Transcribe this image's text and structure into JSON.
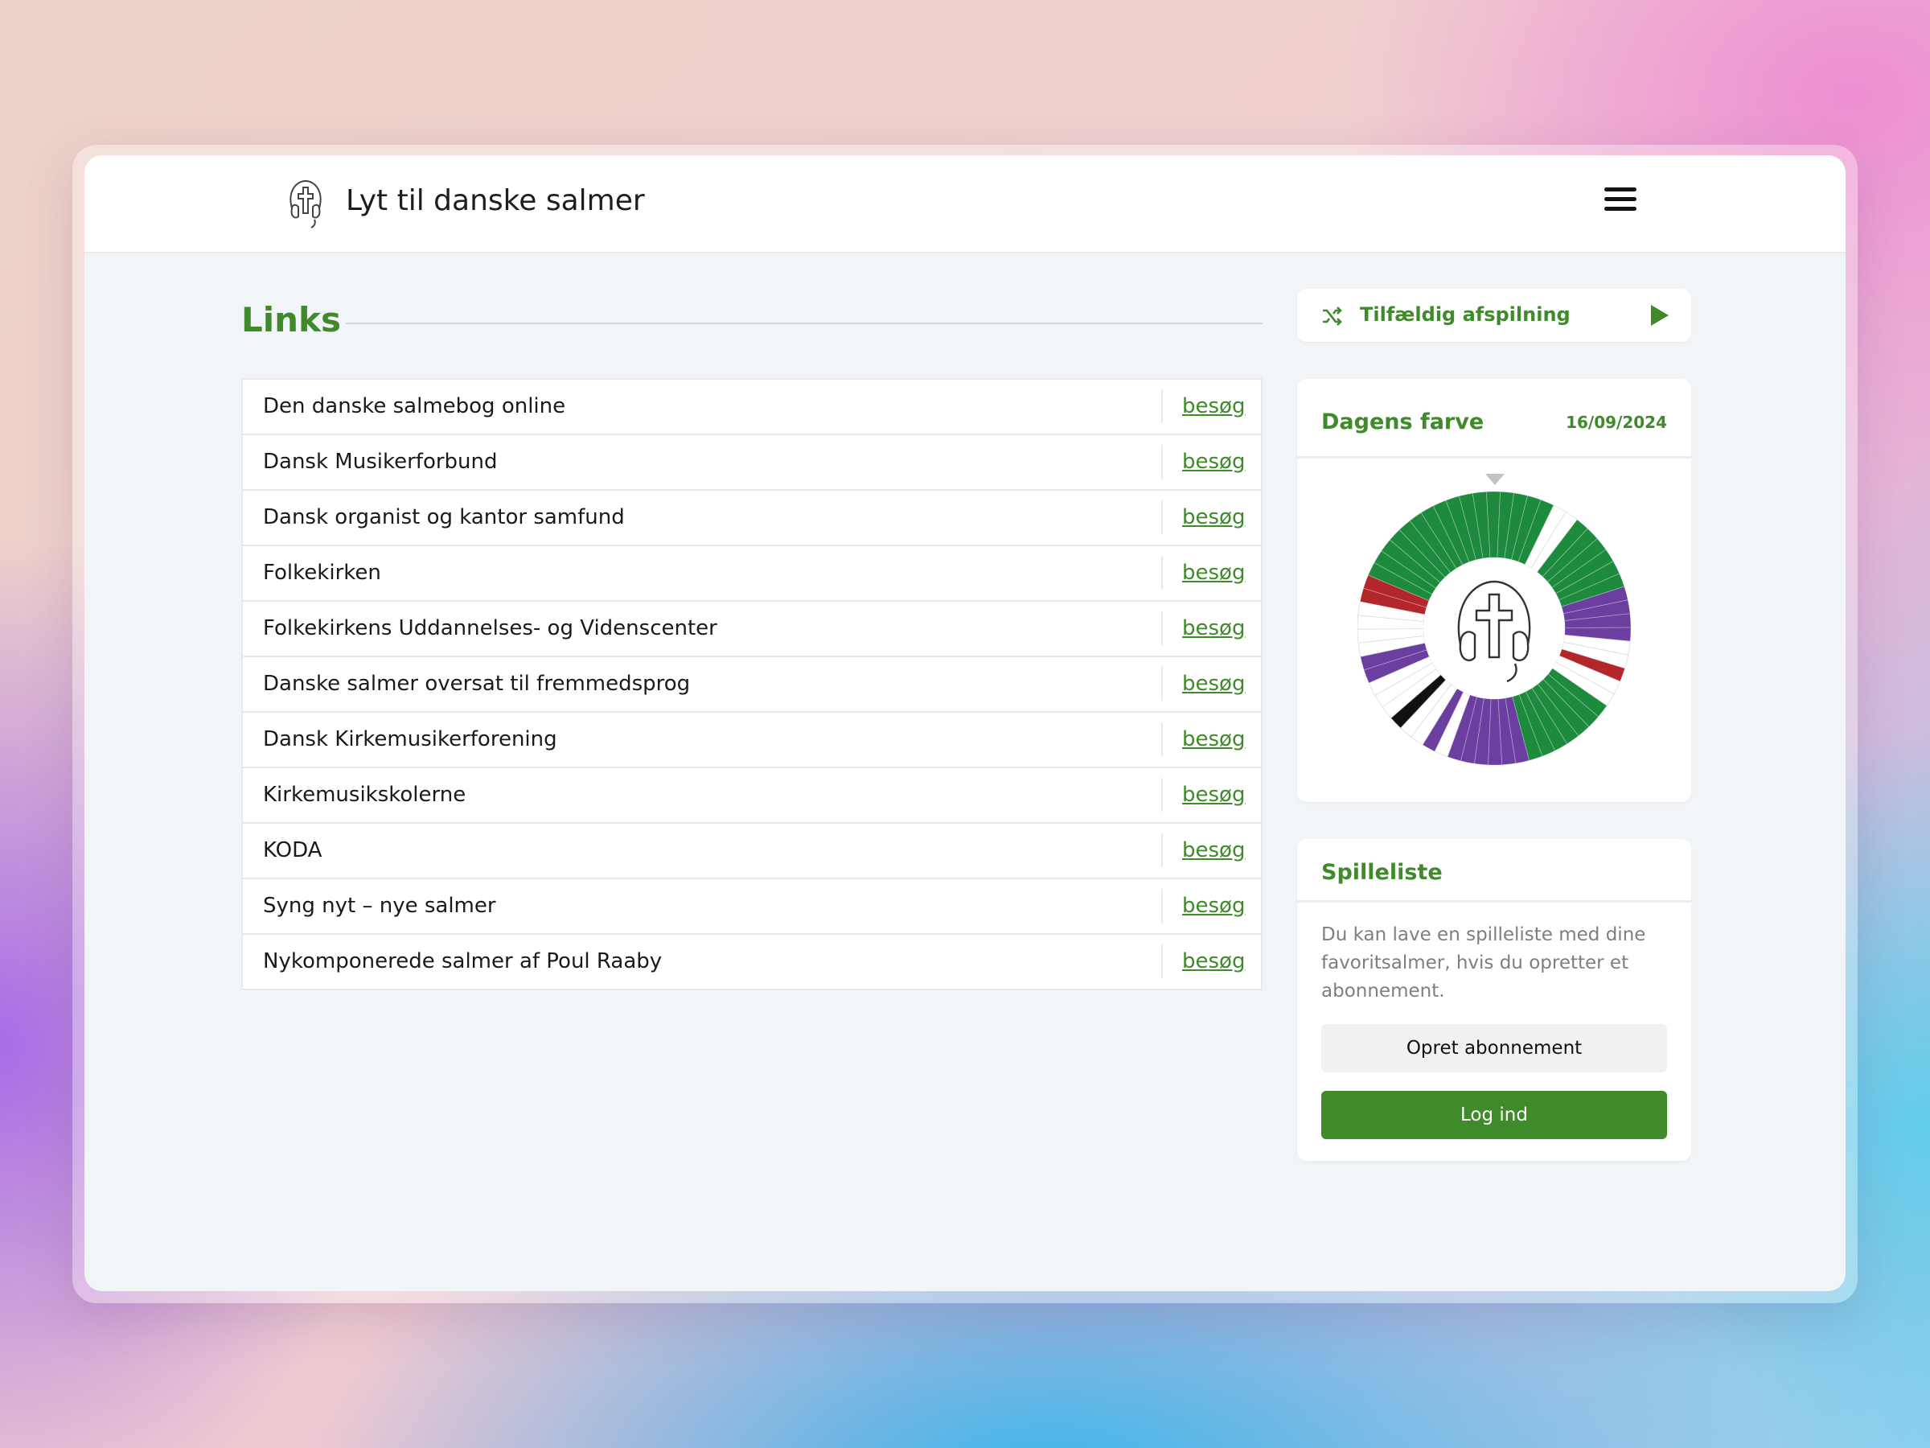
{
  "header": {
    "title": "Lyt til danske salmer"
  },
  "links": {
    "title": "Links",
    "visit_label": "besøg",
    "items": [
      "Den danske salmebog online",
      "Dansk Musikerforbund",
      "Dansk organist og kantor samfund",
      "Folkekirken",
      "Folkekirkens Uddannelses- og Videnscenter",
      "Danske salmer oversat til fremmedsprog",
      "Dansk Kirkemusikerforening",
      "Kirkemusikskolerne",
      "KODA",
      "Syng nyt – nye salmer",
      "Nykomponerede salmer af Poul Raaby"
    ]
  },
  "shuffle": {
    "label": "Tilfældig afspilning"
  },
  "day_color": {
    "title": "Dagens farve",
    "date": "16/09/2024"
  },
  "playlist": {
    "title": "Spilleliste",
    "text": "Du kan lave en spilleliste med dine favoritsalmer, hvis du opretter et abonnement.",
    "subscribe_label": "Opret abonnement",
    "login_label": "Log ind"
  },
  "colors": {
    "accent": "#3f8a2a",
    "liturgical_green": "#1e8a3e",
    "liturgical_purple": "#6b3fa0",
    "liturgical_red": "#b3262b",
    "liturgical_black": "#111111",
    "liturgical_white": "#ffffff"
  }
}
